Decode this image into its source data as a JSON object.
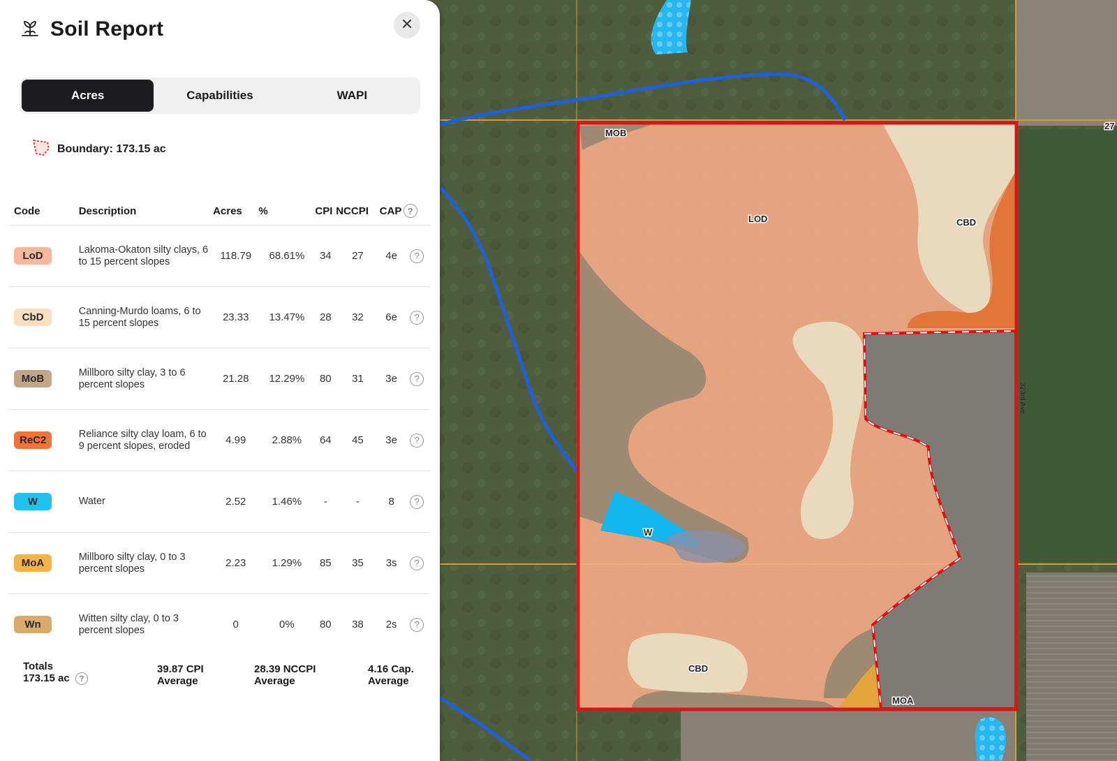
{
  "panel": {
    "title": "Soil Report",
    "tabs": [
      "Acres",
      "Capabilities",
      "WAPI"
    ],
    "active_tab": "Acres",
    "boundary": "Boundary: 173.15 ac"
  },
  "table": {
    "headers": [
      "Code",
      "Description",
      "Acres",
      "%",
      "CPI",
      "NCCPI",
      "CAP"
    ],
    "rows": [
      {
        "code": "LoD",
        "color": "#f6b79a",
        "desc": "Lakoma-Okaton silty clays, 6 to 15 percent slopes",
        "acres": "118.79",
        "pct": "68.61%",
        "cpi": "34",
        "nccpi": "27",
        "cap": "4e"
      },
      {
        "code": "CbD",
        "color": "#f7dfc0",
        "desc": "Canning-Murdo loams, 6 to 15 percent slopes",
        "acres": "23.33",
        "pct": "13.47%",
        "cpi": "28",
        "nccpi": "32",
        "cap": "6e"
      },
      {
        "code": "MoB",
        "color": "#c2a68a",
        "desc": "Millboro silty clay, 3 to 6 percent slopes",
        "acres": "21.28",
        "pct": "12.29%",
        "cpi": "80",
        "nccpi": "31",
        "cap": "3e"
      },
      {
        "code": "ReC2",
        "color": "#f0733a",
        "desc": "Reliance silty clay loam, 6 to 9 percent slopes, eroded",
        "acres": "4.99",
        "pct": "2.88%",
        "cpi": "64",
        "nccpi": "45",
        "cap": "3e"
      },
      {
        "code": "W",
        "color": "#1fc4ee",
        "desc": "Water",
        "acres": "2.52",
        "pct": "1.46%",
        "cpi": "-",
        "nccpi": "-",
        "cap": "8"
      },
      {
        "code": "MoA",
        "color": "#f5b24a",
        "desc": "Millboro silty clay, 0 to 3 percent slopes",
        "acres": "2.23",
        "pct": "1.29%",
        "cpi": "85",
        "nccpi": "35",
        "cap": "3s"
      },
      {
        "code": "Wn",
        "color": "#d9ab6a",
        "desc": "Witten silty clay, 0 to 3 percent slopes",
        "acres": "0",
        "pct": "0%",
        "cpi": "80",
        "nccpi": "38",
        "cap": "2s"
      }
    ]
  },
  "totals": {
    "label": "Totals",
    "acres": "173.15 ac",
    "cpi_value": "39.87 CPI",
    "cpi_label": "Average",
    "nccpi_value": "28.39 NCCPI",
    "nccpi_label": "Average",
    "cap_value": "4.16 Cap.",
    "cap_label": "Average"
  },
  "map": {
    "labels": {
      "lod": "LOD",
      "cbd_top": "CBD",
      "cbd_bottom": "CBD",
      "mob": "MOB",
      "w": "W",
      "moa": "MOA",
      "road": "323rd Ave",
      "edge": "27"
    }
  }
}
